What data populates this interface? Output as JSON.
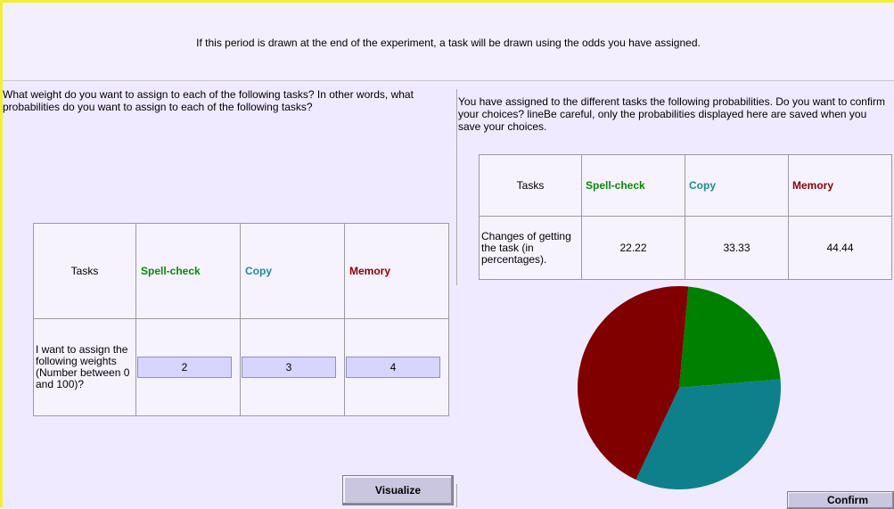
{
  "header": {
    "text": "If this period is drawn at the end of the experiment, a task will be drawn using the odds you have assigned."
  },
  "left": {
    "question": "What weight do you want to assign to each of the following tasks? In other words, what probabilities do you want to assign to each of the following tasks?",
    "table": {
      "header": [
        "Tasks",
        "Spell-check",
        "Copy",
        "Memory"
      ],
      "row_label": "I want to assign the following weights (Number between 0 and 100)?",
      "values": [
        "2",
        "3",
        "4"
      ]
    },
    "visualize_label": "Visualize"
  },
  "right": {
    "summary": "You have assigned to the different tasks the following probabilities. Do you want to confirm your choices? lineBe careful, only the probabilities displayed here are saved when you save your choices.",
    "table": {
      "header": [
        "Tasks",
        "Spell-check",
        "Copy",
        "Memory"
      ],
      "row_label": "Changes of getting the task (in percentages).",
      "values": [
        "22.22",
        "33.33",
        "44.44"
      ]
    },
    "pie": [
      {
        "task": "Spell-check",
        "percent": 22.22,
        "color": "#008000"
      },
      {
        "task": "Copy",
        "percent": 33.33,
        "color": "#0d808c"
      },
      {
        "task": "Memory",
        "percent": 44.44,
        "color": "#800000"
      }
    ],
    "confirm_label": "Confirm"
  },
  "colors": {
    "spell_check": "#0a8a0a",
    "copy": "#1e8a96",
    "memory": "#8b0000",
    "background": "#efeaff"
  }
}
